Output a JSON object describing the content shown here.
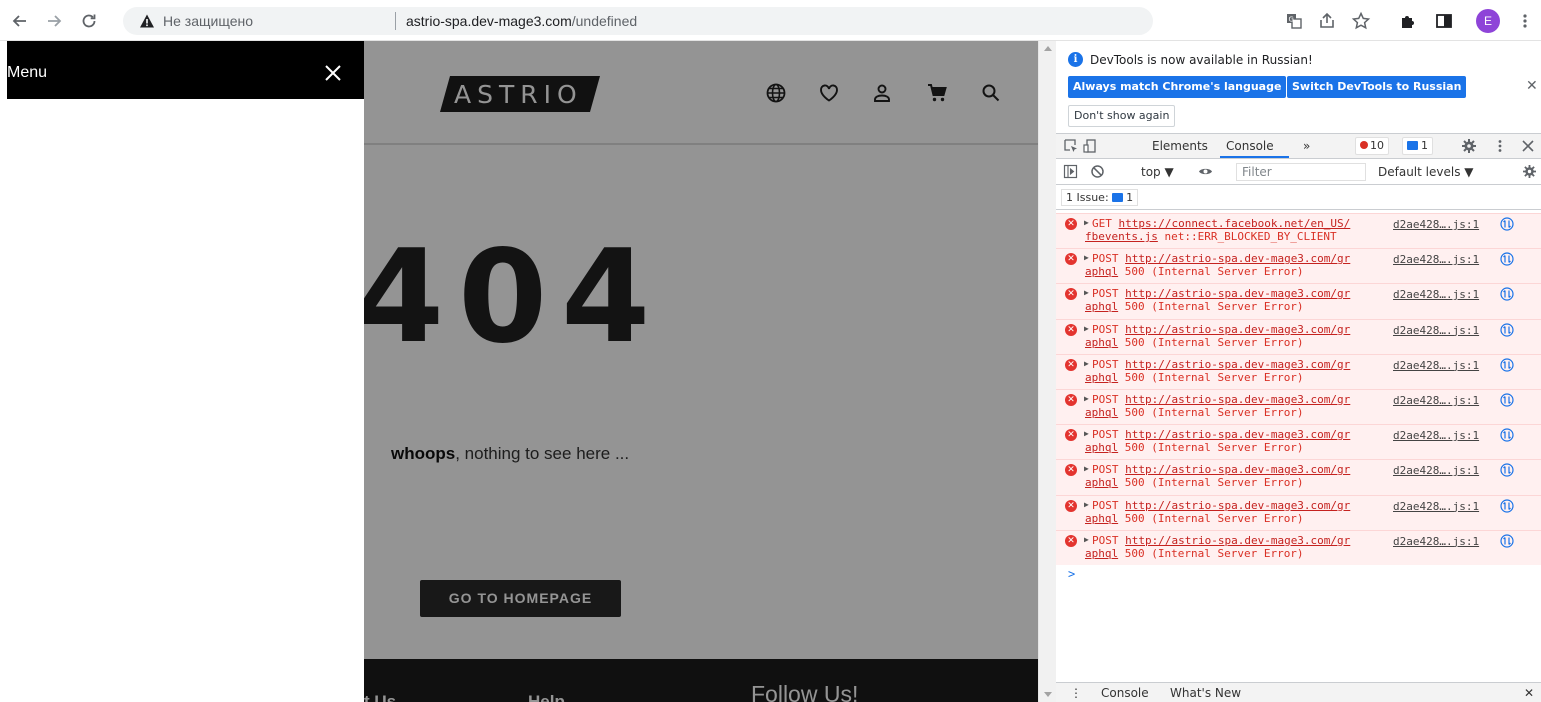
{
  "browser": {
    "security_label": "Не защищено",
    "url_host": "astrio-spa.dev-mage3.com",
    "url_path": "/undefined",
    "profile_initial": "E",
    "profile_color": "#8e44d8"
  },
  "site": {
    "logo": "ASTRIO",
    "error_code": "404",
    "whoops_bold": "whoops",
    "whoops_rest": ", nothing to see here ...",
    "home_button": "GO TO HOMEPAGE",
    "footer": {
      "col1": "t Us",
      "col2": "Help",
      "col3": "Follow Us!"
    }
  },
  "menu": {
    "title": "Menu"
  },
  "devtools": {
    "info_text": "DevTools is now available in Russian!",
    "btn_match": "Always match Chrome's language",
    "btn_switch": "Switch DevTools to Russian",
    "btn_dont_show": "Don't show again",
    "tabs": {
      "elements": "Elements",
      "console": "Console",
      "more": "»"
    },
    "error_count": "10",
    "message_count": "1",
    "context": "top ▼",
    "filter_placeholder": "Filter",
    "levels": "Default levels ▼",
    "issues_label": "1 Issue:",
    "issues_count": "1",
    "log": [
      {
        "method": "GET",
        "url1": "https://connect.facebook.net/en_US/",
        "url2": "fbevents.js",
        "msg": " net::ERR_BLOCKED_BY_CLIENT",
        "src": "d2ae428….js:1"
      },
      {
        "method": "POST",
        "url1": "http://astrio-spa.dev-mage3.com/gr",
        "url2": "aphql",
        "msg": " 500 (Internal Server Error)",
        "src": "d2ae428….js:1"
      },
      {
        "method": "POST",
        "url1": "http://astrio-spa.dev-mage3.com/gr",
        "url2": "aphql",
        "msg": " 500 (Internal Server Error)",
        "src": "d2ae428….js:1"
      },
      {
        "method": "POST",
        "url1": "http://astrio-spa.dev-mage3.com/gr",
        "url2": "aphql",
        "msg": " 500 (Internal Server Error)",
        "src": "d2ae428….js:1"
      },
      {
        "method": "POST",
        "url1": "http://astrio-spa.dev-mage3.com/gr",
        "url2": "aphql",
        "msg": " 500 (Internal Server Error)",
        "src": "d2ae428….js:1"
      },
      {
        "method": "POST",
        "url1": "http://astrio-spa.dev-mage3.com/gr",
        "url2": "aphql",
        "msg": " 500 (Internal Server Error)",
        "src": "d2ae428….js:1"
      },
      {
        "method": "POST",
        "url1": "http://astrio-spa.dev-mage3.com/gr",
        "url2": "aphql",
        "msg": " 500 (Internal Server Error)",
        "src": "d2ae428….js:1"
      },
      {
        "method": "POST",
        "url1": "http://astrio-spa.dev-mage3.com/gr",
        "url2": "aphql",
        "msg": " 500 (Internal Server Error)",
        "src": "d2ae428….js:1"
      },
      {
        "method": "POST",
        "url1": "http://astrio-spa.dev-mage3.com/gr",
        "url2": "aphql",
        "msg": " 500 (Internal Server Error)",
        "src": "d2ae428….js:1"
      },
      {
        "method": "POST",
        "url1": "http://astrio-spa.dev-mage3.com/gr",
        "url2": "aphql",
        "msg": " 500 (Internal Server Error)",
        "src": "d2ae428….js:1"
      }
    ],
    "prompt": ">",
    "drawer_console": "Console",
    "drawer_whats_new": "What's New"
  },
  "icons": [
    "back-arrow-icon",
    "forward-arrow-icon",
    "reload-icon",
    "warning-icon",
    "translate-icon",
    "share-icon",
    "star-icon",
    "extensions-icon",
    "sidepanel-icon",
    "kebab-menu-icon",
    "globe-icon",
    "heart-icon",
    "user-icon",
    "cart-icon",
    "search-icon",
    "close-icon",
    "inspect-icon",
    "device-icon",
    "gear-icon",
    "sidebar-icon",
    "clear-icon",
    "eye-icon",
    "network-icon"
  ]
}
